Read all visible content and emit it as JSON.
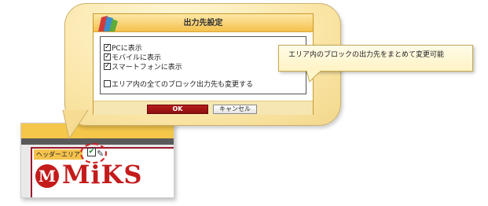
{
  "dialog": {
    "title": "出力先設定",
    "options": [
      {
        "label": "PCに表示",
        "checked": true
      },
      {
        "label": "モバイルに表示",
        "checked": true
      },
      {
        "label": "スマートフォンに表示",
        "checked": true
      },
      {
        "label": "エリア内の全てのブロック出力先も変更する",
        "checked": false
      }
    ],
    "ok_label": "OK",
    "cancel_label": "キャンセル"
  },
  "callout": {
    "text": "エリア内のブロックの出力先をまとめて変更可能"
  },
  "background_page": {
    "area_label": "ヘッダーエリア",
    "logo_mark": "M",
    "logo_text": "MiKS"
  },
  "colors": {
    "accent_red": "#c41b1b",
    "header_gold": "#f5c14d",
    "bubble_yellow": "#fbe6a8"
  },
  "icons": [
    "app-logo-icon",
    "checkbox-icon",
    "edit-pen-icon"
  ]
}
